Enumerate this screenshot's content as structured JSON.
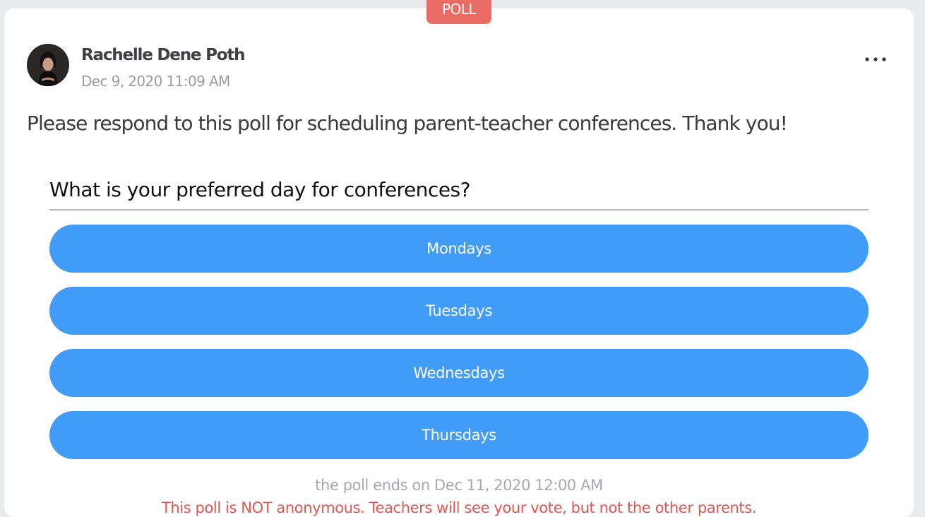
{
  "badge": {
    "label": "POLL"
  },
  "post": {
    "author": "Rachelle Dene Poth",
    "date": "Dec 9, 2020 11:09 AM",
    "text": "Please respond to this poll for scheduling parent-teacher conferences. Thank you!",
    "avatar_icon": "user-avatar",
    "more_icon": "more-horizontal-icon"
  },
  "poll": {
    "question": "What is your preferred day for conferences?",
    "options": [
      "Mondays",
      "Tuesdays",
      "Wednesdays",
      "Thursdays"
    ],
    "ends": "the poll ends on Dec 11, 2020 12:00 AM",
    "note": "This poll is NOT anonymous. Teachers will see your vote, but not the other parents."
  },
  "colors": {
    "badge": "#e96b63",
    "option": "#419cf7",
    "note": "#e0574f"
  }
}
